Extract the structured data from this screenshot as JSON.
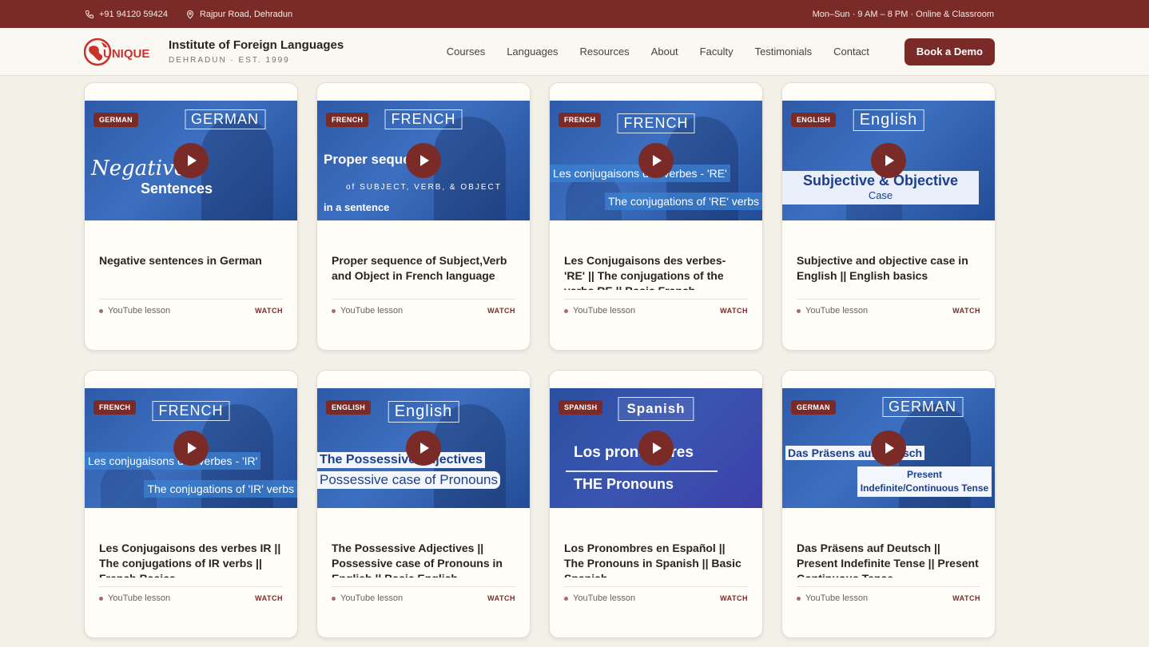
{
  "topbar": {
    "phone": "+91 94120 59424",
    "address": "Rajpur Road, Dehradun",
    "hours": "Mon–Sun · 9 AM – 8 PM · Online & Classroom"
  },
  "brand": {
    "logo_text": "UNIQUE",
    "name": "Institute of Foreign Languages",
    "sub": "DEHRADUN · EST. 1999"
  },
  "nav": {
    "courses": "Courses",
    "languages": "Languages",
    "resources": "Resources",
    "about": "About",
    "faculty": "Faculty",
    "testimonials": "Testimonials",
    "contact": "Contact",
    "cta": "Book a Demo"
  },
  "colors": {
    "brand": "#7b2b27",
    "thumb_blue": "#2e5aa8",
    "background": "#f3f0e8"
  },
  "card_meta": {
    "lesson_label": "YouTube lesson",
    "watch_label": "WATCH"
  },
  "cards": [
    {
      "badge": "GERMAN",
      "thumb_lang": "GERMAN",
      "thumb_lines": [
        "Negative",
        "Sentences"
      ],
      "title": "Negative sentences in German"
    },
    {
      "badge": "FRENCH",
      "thumb_lang": "FRENCH",
      "thumb_lines": [
        "Proper sequence",
        "of SUBJECT, VERB, & OBJECT",
        "in a sentence"
      ],
      "title": "Proper sequence of Subject,Verb and Object in French language"
    },
    {
      "badge": "FRENCH",
      "thumb_lang": "FRENCH",
      "thumb_lines": [
        "Les conjugaisons des verbes - 'RE'",
        "The conjugations of 'RE' verbs"
      ],
      "title": "Les Conjugaisons des verbes- 'RE' || The conjugations of the verbs RE || Basic French"
    },
    {
      "badge": "ENGLISH",
      "thumb_lang": "English",
      "thumb_lines": [
        "Subjective & Objective",
        "Case"
      ],
      "title": "Subjective and objective case in English || English basics"
    },
    {
      "badge": "FRENCH",
      "thumb_lang": "FRENCH",
      "thumb_lines": [
        "Les conjugaisons des verbes - 'IR'",
        "The conjugations of 'IR' verbs"
      ],
      "title": "Les Conjugaisons des verbes IR || The conjugations of IR verbs || French Basics"
    },
    {
      "badge": "ENGLISH",
      "thumb_lang": "English",
      "thumb_lines": [
        "The Possessive Adjectives",
        "Possessive case of Pronouns"
      ],
      "title": "The Possessive Adjectives || Possessive case of Pronouns in English || Basic English"
    },
    {
      "badge": "SPANISH",
      "thumb_lang": "Spanish",
      "thumb_lines": [
        "Los pronombres",
        "THE Pronouns"
      ],
      "title": "Los Pronombres en Español || The Pronouns in Spanish || Basic Spanish"
    },
    {
      "badge": "GERMAN",
      "thumb_lang": "GERMAN",
      "thumb_lines": [
        "Das Präsens auf Deutsch",
        "Present Indefinite/Continuous Tense"
      ],
      "title": "Das Präsens auf Deutsch || Present Indefinite Tense || Present Continuous Tense"
    }
  ]
}
